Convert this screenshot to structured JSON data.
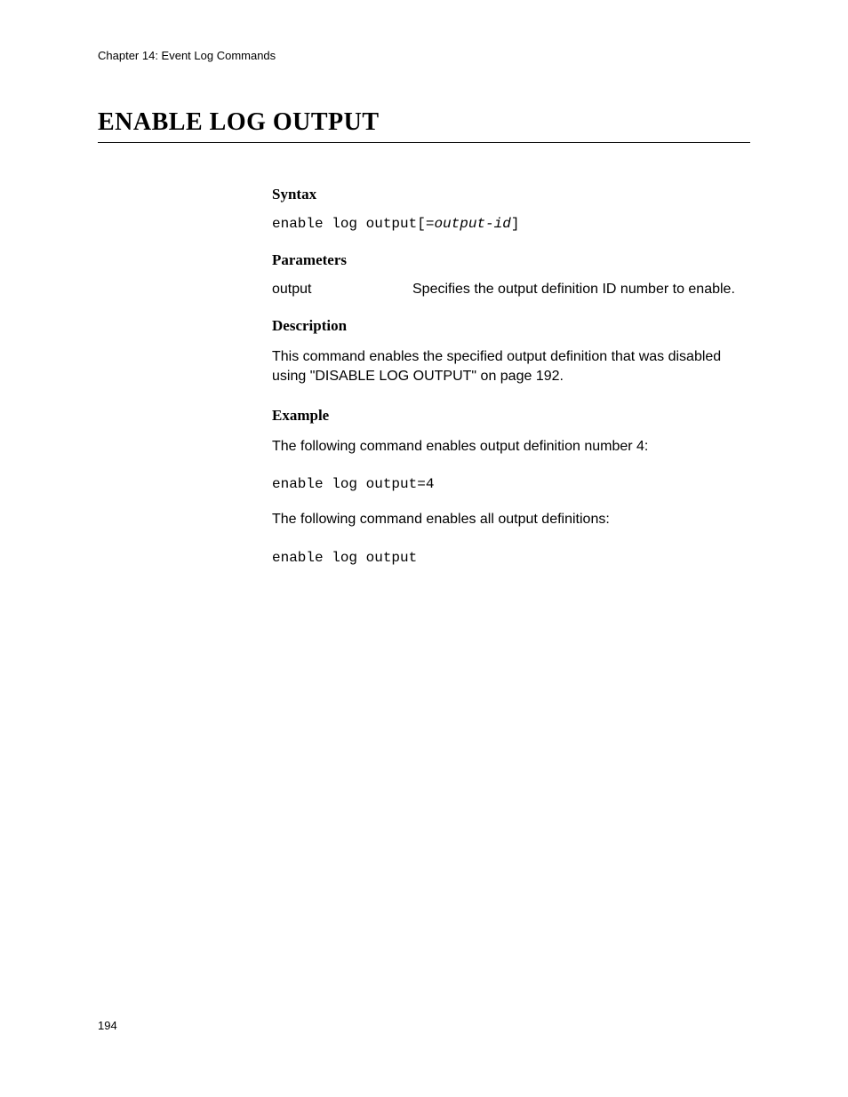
{
  "header": {
    "chapter": "Chapter 14: Event Log Commands"
  },
  "title": "ENABLE LOG OUTPUT",
  "sections": {
    "syntax": {
      "heading": "Syntax",
      "code_prefix": "enable log output[=",
      "code_var": "output-id",
      "code_suffix": "]"
    },
    "parameters": {
      "heading": "Parameters",
      "rows": [
        {
          "name": "output",
          "description": "Specifies the output definition ID number to enable."
        }
      ]
    },
    "description": {
      "heading": "Description",
      "text": "This command enables the specified output definition that was disabled using \"DISABLE LOG OUTPUT\" on page 192."
    },
    "example": {
      "heading": "Example",
      "intro1": "The following command enables output definition number 4:",
      "code1": "enable log output=4",
      "intro2": "The following command enables all output definitions:",
      "code2": "enable log output"
    }
  },
  "pageNumber": "194"
}
